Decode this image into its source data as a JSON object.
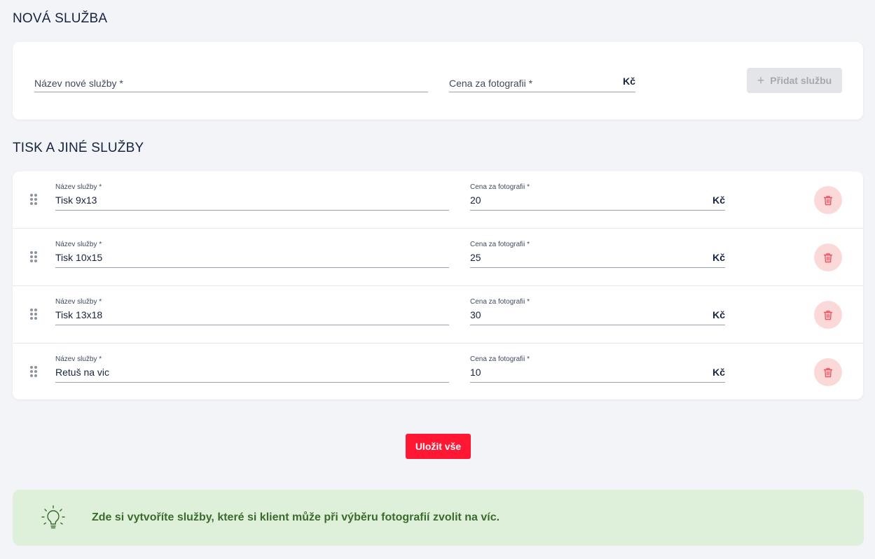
{
  "new_service": {
    "title": "NOVÁ SLUŽBA",
    "name_placeholder": "Název nové služby *",
    "price_placeholder": "Cena za fotografii *",
    "currency": "Kč",
    "add_button": "Přidat službu"
  },
  "services": {
    "title": "TISK A JINÉ SLUŽBY",
    "name_label": "Název služby *",
    "price_label": "Cena za fotografii *",
    "currency": "Kč",
    "rows": [
      {
        "name": "Tisk 9x13",
        "price": "20"
      },
      {
        "name": "Tisk 10x15",
        "price": "25"
      },
      {
        "name": "Tisk 13x18",
        "price": "30"
      },
      {
        "name": "Retuš na vic",
        "price": "10"
      }
    ]
  },
  "save_button": "Uložit vše",
  "tip": {
    "icon": "lightbulb-icon",
    "text": "Zde si vytvoříte služby, které si klient může při výběru fotografií zvolit na víc."
  },
  "colors": {
    "accent": "#ff1733",
    "delete_bg": "#fcd9d9",
    "delete_icon": "#f0535f",
    "tip_bg": "#dff0da",
    "tip_text": "#3a6b2c"
  }
}
